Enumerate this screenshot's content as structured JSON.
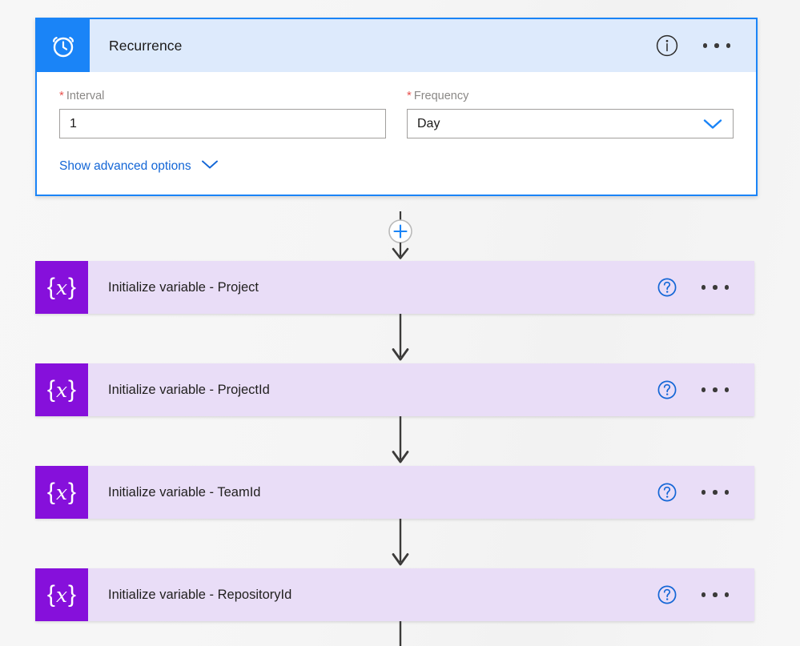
{
  "canvas": {
    "background_color": "#f5f5f5"
  },
  "trigger": {
    "name": "recurrence-trigger",
    "title": "Recurrence",
    "icon": "alarm-clock-icon",
    "accent_color": "#1a84f7",
    "header_background": "#ddeafc",
    "info_icon": "info-circle-icon",
    "more_icon": "more-ellipsis-icon",
    "fields": [
      {
        "label": "Interval",
        "required": true,
        "required_marker": "*",
        "type": "text",
        "value": "1",
        "placeholder": ""
      },
      {
        "label": "Frequency",
        "required": true,
        "required_marker": "*",
        "type": "select",
        "value": "Day",
        "chevron_icon": "chevron-down-icon"
      }
    ],
    "advanced_options_label": "Show advanced options",
    "advanced_options_icon": "chevron-down-icon",
    "link_color": "#1366d6"
  },
  "connectors": {
    "add_step_icon": "plus-icon",
    "add_step_color": "#1a84f7",
    "arrow_color": "#3b3a39"
  },
  "actions": [
    {
      "title": "Initialize variable - Project",
      "icon": "variable-braces-x-icon",
      "icon_color": "#8610db",
      "card_color": "#e9ddf7",
      "help_icon": "help-circle-icon",
      "more_icon": "more-ellipsis-icon"
    },
    {
      "title": "Initialize variable - ProjectId",
      "icon": "variable-braces-x-icon",
      "icon_color": "#8610db",
      "card_color": "#e9ddf7",
      "help_icon": "help-circle-icon",
      "more_icon": "more-ellipsis-icon"
    },
    {
      "title": "Initialize variable - TeamId",
      "icon": "variable-braces-x-icon",
      "icon_color": "#8610db",
      "card_color": "#e9ddf7",
      "help_icon": "help-circle-icon",
      "more_icon": "more-ellipsis-icon"
    },
    {
      "title": "Initialize variable - RepositoryId",
      "icon": "variable-braces-x-icon",
      "icon_color": "#8610db",
      "card_color": "#e9ddf7",
      "help_icon": "help-circle-icon",
      "more_icon": "more-ellipsis-icon"
    }
  ]
}
